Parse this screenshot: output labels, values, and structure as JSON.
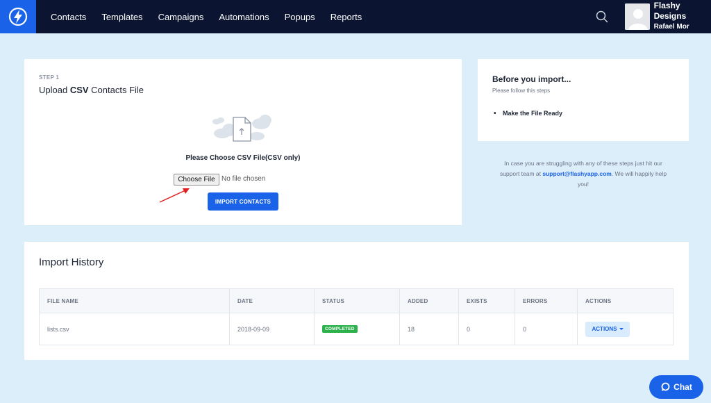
{
  "nav": {
    "items": [
      "Contacts",
      "Templates",
      "Campaigns",
      "Automations",
      "Popups",
      "Reports"
    ],
    "logo_icon": "lightning-bolt-icon",
    "search_icon": "search-icon"
  },
  "user": {
    "company": "Flashy Designs",
    "name": "Rafael Mor",
    "avatar_icon": "user-avatar-icon"
  },
  "upload": {
    "step": "STEP 1",
    "title_prefix": "Upload ",
    "title_bold": "CSV",
    "title_suffix": " Contacts File",
    "choose_label": "Please Choose CSV File(CSV only)",
    "file_button": "Choose File",
    "file_status": "No file chosen",
    "import_button": "IMPORT CONTACTS",
    "illustration_icon": "cloud-file-upload-icon"
  },
  "before": {
    "title": "Before you import...",
    "subtitle": "Please follow this steps",
    "items": [
      "Make the File Ready"
    ]
  },
  "help": {
    "text_before": "In case you are struggling with any of these steps just hit our support team at ",
    "email": "support@flashyapp.com",
    "text_after": ". We will happily help you!"
  },
  "history": {
    "title": "Import History",
    "columns": [
      "FILE NAME",
      "DATE",
      "STATUS",
      "ADDED",
      "EXISTS",
      "ERRORS",
      "ACTIONS"
    ],
    "rows": [
      {
        "file_name": "lists.csv",
        "date": "2018-09-09",
        "status": "COMPLETED",
        "added": "18",
        "exists": "0",
        "errors": "0",
        "action": "ACTIONS"
      }
    ]
  },
  "chat": {
    "label": "Chat",
    "icon": "chat-bubble-icon"
  },
  "colors": {
    "nav_bg": "#0b1531",
    "accent": "#1a63e8",
    "page_bg": "#ddeefb",
    "status_completed": "#2bb24c"
  }
}
